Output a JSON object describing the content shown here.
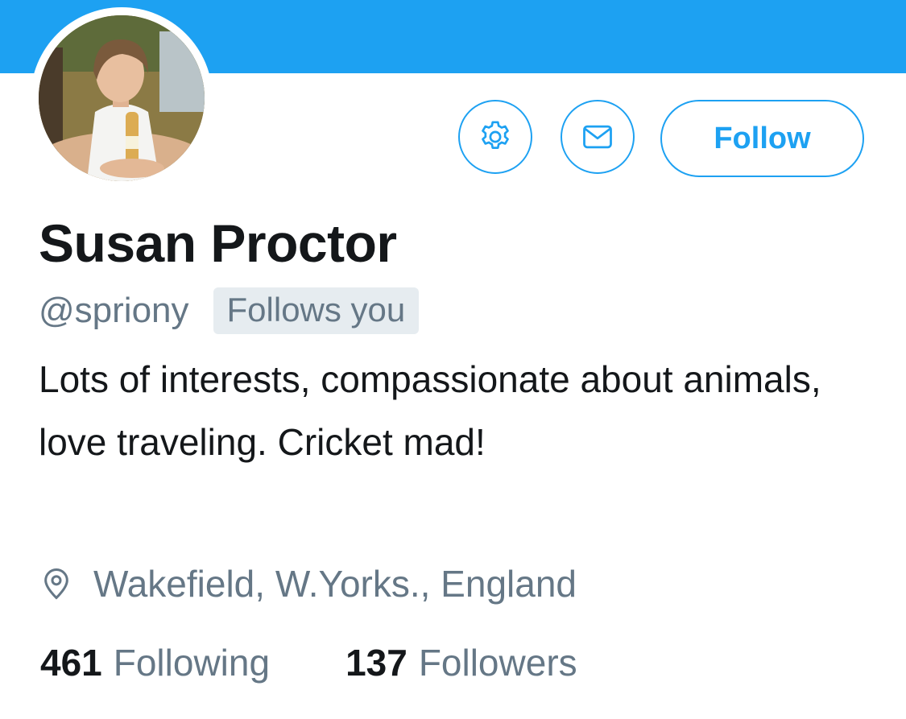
{
  "profile": {
    "display_name": "Susan Proctor",
    "handle": "@spriony",
    "follows_you_badge": "Follows you",
    "bio": "Lots of interests, compassionate about animals, love traveling. Cricket mad!",
    "location": "Wakefield, W.Yorks., England"
  },
  "actions": {
    "settings_icon": "gear-icon",
    "message_icon": "envelope-icon",
    "follow_label": "Follow"
  },
  "stats": {
    "following_count": "461",
    "following_label": "Following",
    "followers_count": "137",
    "followers_label": "Followers"
  },
  "colors": {
    "brand_blue": "#1DA1F2",
    "text_primary": "#14171A",
    "text_secondary": "#657786",
    "badge_background": "#E6ECF0"
  }
}
